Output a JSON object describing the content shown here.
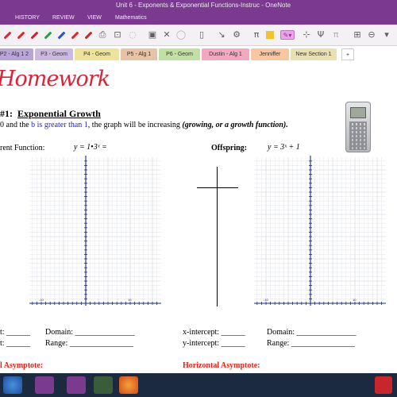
{
  "window": {
    "title": "Unit 6 - Exponents & Exponential Functions-Instruc - OneNote"
  },
  "ribbon_tabs": [
    {
      "label": "HISTORY"
    },
    {
      "label": "REVIEW"
    },
    {
      "label": "VIEW"
    },
    {
      "label": "Mathematics"
    }
  ],
  "section_tabs": [
    {
      "label": "P2 - Alg 1 2",
      "color": "#b9a4d8"
    },
    {
      "label": "P3 - Geom",
      "color": "#cdb8e0"
    },
    {
      "label": "P4 - Geom",
      "color": "#efe39b"
    },
    {
      "label": "P5 - Alg 1",
      "color": "#e8c2a4"
    },
    {
      "label": "P6 - Geom",
      "color": "#c2e0a4"
    },
    {
      "label": "Dustin - Alg 1",
      "color": "#f1a8c0"
    },
    {
      "label": "Jenniffer",
      "color": "#f8c6a0"
    },
    {
      "label": "New Section 1",
      "color": "#e9e0b4"
    }
  ],
  "add_tab_label": "+",
  "page": {
    "handwritten_title": "Homework",
    "heading_number": "#1:",
    "heading_title": "Exponential Growth",
    "rule_text_1": "0 and the",
    "rule_blue": "b is greater than 1",
    "rule_text_2": ", the graph will be increasing",
    "rule_bold": "(growing, or a growth function).",
    "left_label": "rent Function:",
    "left_equation": "y = 1•3ˣ =",
    "right_label": "Offspring:",
    "right_equation": "y = 3ˣ + 1",
    "left_fields": [
      {
        "text": "t: ______",
        "text2": "Domain: _______________"
      },
      {
        "text": "t: ______",
        "text2": "Range: ________________"
      }
    ],
    "right_fields": [
      {
        "text": "x-intercept: ______",
        "text2": "Domain: _______________"
      },
      {
        "text": "y-intercept: ______",
        "text2": "Range: ________________"
      }
    ],
    "left_asymptote": "l Asymptote:",
    "right_asymptote": "Horizontal Asymptote:",
    "graph_ticks": {
      "neg": "-10",
      "pos": "10"
    }
  },
  "colors": {
    "accent": "#7b3a8f",
    "title_red": "#d9243a",
    "asymptote_red": "#e2231a",
    "rule_blue": "#2222dd"
  }
}
